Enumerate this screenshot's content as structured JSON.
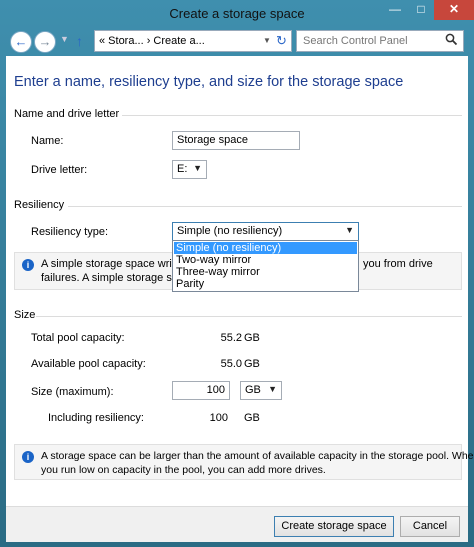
{
  "window": {
    "title": "Create a storage space",
    "minimize_glyph": "—",
    "maximize_glyph": "□",
    "close_glyph": "✕"
  },
  "nav": {
    "back_glyph": "←",
    "forward_glyph": "→",
    "up_glyph": "↑",
    "address": "« Stora...  ›  Create a...",
    "refresh_glyph": "↻",
    "search_placeholder": "Search Control Panel",
    "search_icon": "search-icon"
  },
  "heading": "Enter a name, resiliency type, and size for the storage space",
  "name_section": {
    "title": "Name and drive letter",
    "name_label": "Name:",
    "name_value": "Storage space",
    "drive_label": "Drive letter:",
    "drive_value": "E:"
  },
  "resiliency_section": {
    "title": "Resiliency",
    "type_label": "Resiliency type:",
    "type_value": "Simple (no resiliency)",
    "options": [
      "Simple (no resiliency)",
      "Two-way mirror",
      "Three-way mirror",
      "Parity"
    ],
    "info_line1": "A simple storage space writes",
    "info_line1_right": "you from drive",
    "info_line2": "failures. A simple storage spac"
  },
  "size_section": {
    "title": "Size",
    "total_label": "Total pool capacity:",
    "total_value": "55.2",
    "total_unit": "GB",
    "available_label": "Available pool capacity:",
    "available_value": "55.0",
    "available_unit": "GB",
    "max_label": "Size (maximum):",
    "max_value": "100",
    "max_unit": "GB",
    "including_label": "Including resiliency:",
    "including_value": "100",
    "including_unit": "GB",
    "info_line1": "A storage space can be larger than the amount of available capacity in the storage pool. When",
    "info_line2": "you run low on capacity in the pool, you can add more drives."
  },
  "footer": {
    "create_label": "Create storage space",
    "cancel_label": "Cancel"
  },
  "colors": {
    "heading": "#1e3e8f",
    "selection": "#3399ff",
    "info_icon": "#1a64c7",
    "close_button": "#c7473c"
  }
}
